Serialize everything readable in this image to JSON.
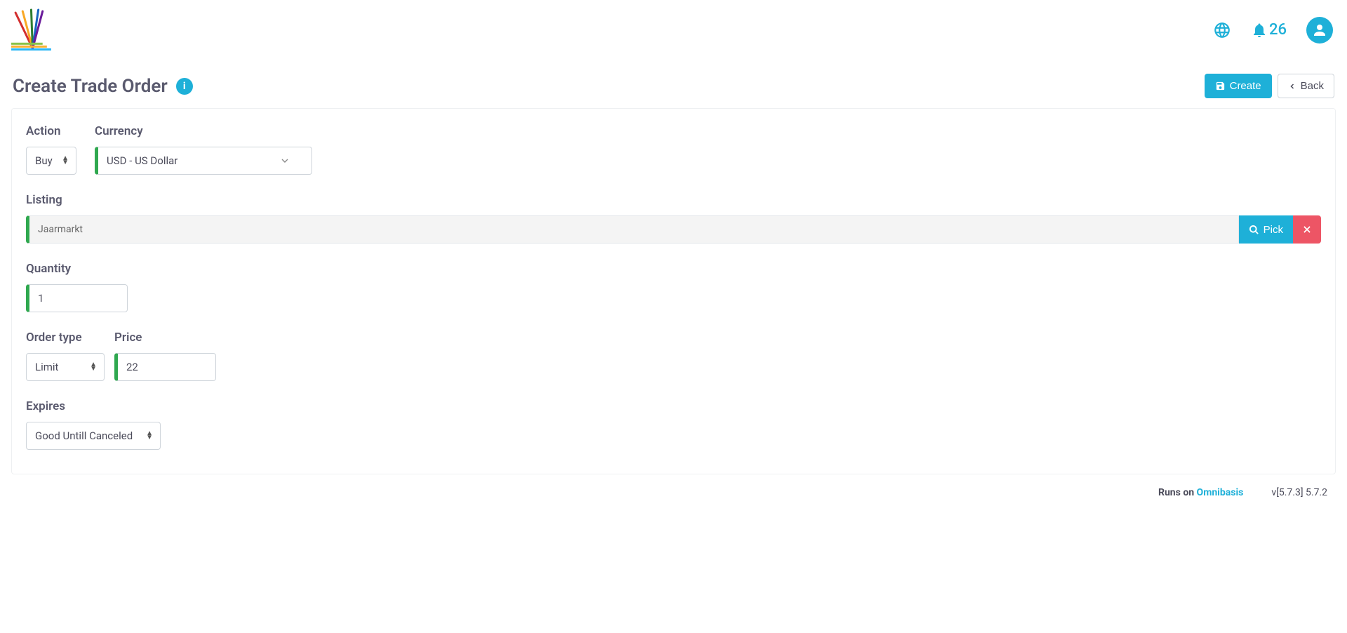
{
  "header": {
    "notification_count": "26"
  },
  "page": {
    "title": "Create Trade Order",
    "create_label": "Create",
    "back_label": "Back"
  },
  "form": {
    "action": {
      "label": "Action",
      "value": "Buy"
    },
    "currency": {
      "label": "Currency",
      "value": "USD - US Dollar"
    },
    "listing": {
      "label": "Listing",
      "value": "Jaarmarkt",
      "pick_label": "Pick"
    },
    "quantity": {
      "label": "Quantity",
      "value": "1"
    },
    "order_type": {
      "label": "Order type",
      "value": "Limit"
    },
    "price": {
      "label": "Price",
      "value": "22"
    },
    "expires": {
      "label": "Expires",
      "value": "Good Untill Canceled"
    }
  },
  "footer": {
    "runs_on": "Runs on",
    "brand": "Omnibasis",
    "version": "v[5.7.3] 5.7.2"
  }
}
